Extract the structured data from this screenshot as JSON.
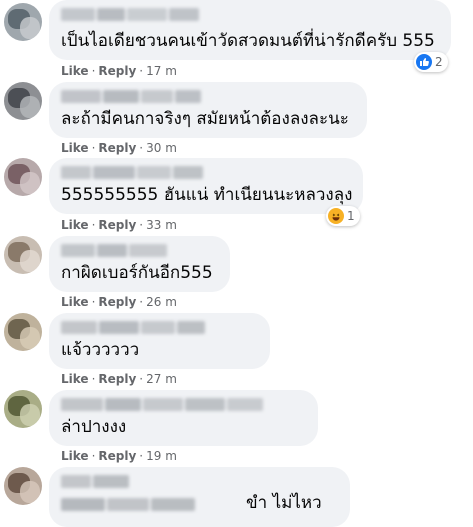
{
  "actions": {
    "like": "Like",
    "reply": "Reply",
    "separator": "·"
  },
  "colors": {
    "bubble": "#f0f2f5",
    "meta": "#65676b",
    "like_blue": "#1877f2",
    "haha_yellow": "#f7b125"
  },
  "comments": [
    {
      "text": "เป็นไอเดียชวนคนเข้าวัดสวดมนต์ที่น่ารักดีครับ 555",
      "time": "17 m",
      "reaction": {
        "icon": "like-icon",
        "count": "2"
      }
    },
    {
      "text": "ละถ้ามีคนกาจริงๆ สมัยหน้าต้องลงละนะ",
      "time": "30 m"
    },
    {
      "text": "555555555 ฮันแน่ ทำเนียนนะหลวงลุง",
      "time": "33 m",
      "reaction": {
        "icon": "haha-icon",
        "count": "1"
      }
    },
    {
      "text": "กาผิดเบอร์กันอีก555",
      "time": "26 m"
    },
    {
      "text": "แจ้วววววว",
      "time": "27 m"
    },
    {
      "text": "ล่าปางงง",
      "time": "19 m"
    },
    {
      "text": "ขำ ไม่ไหว"
    }
  ]
}
